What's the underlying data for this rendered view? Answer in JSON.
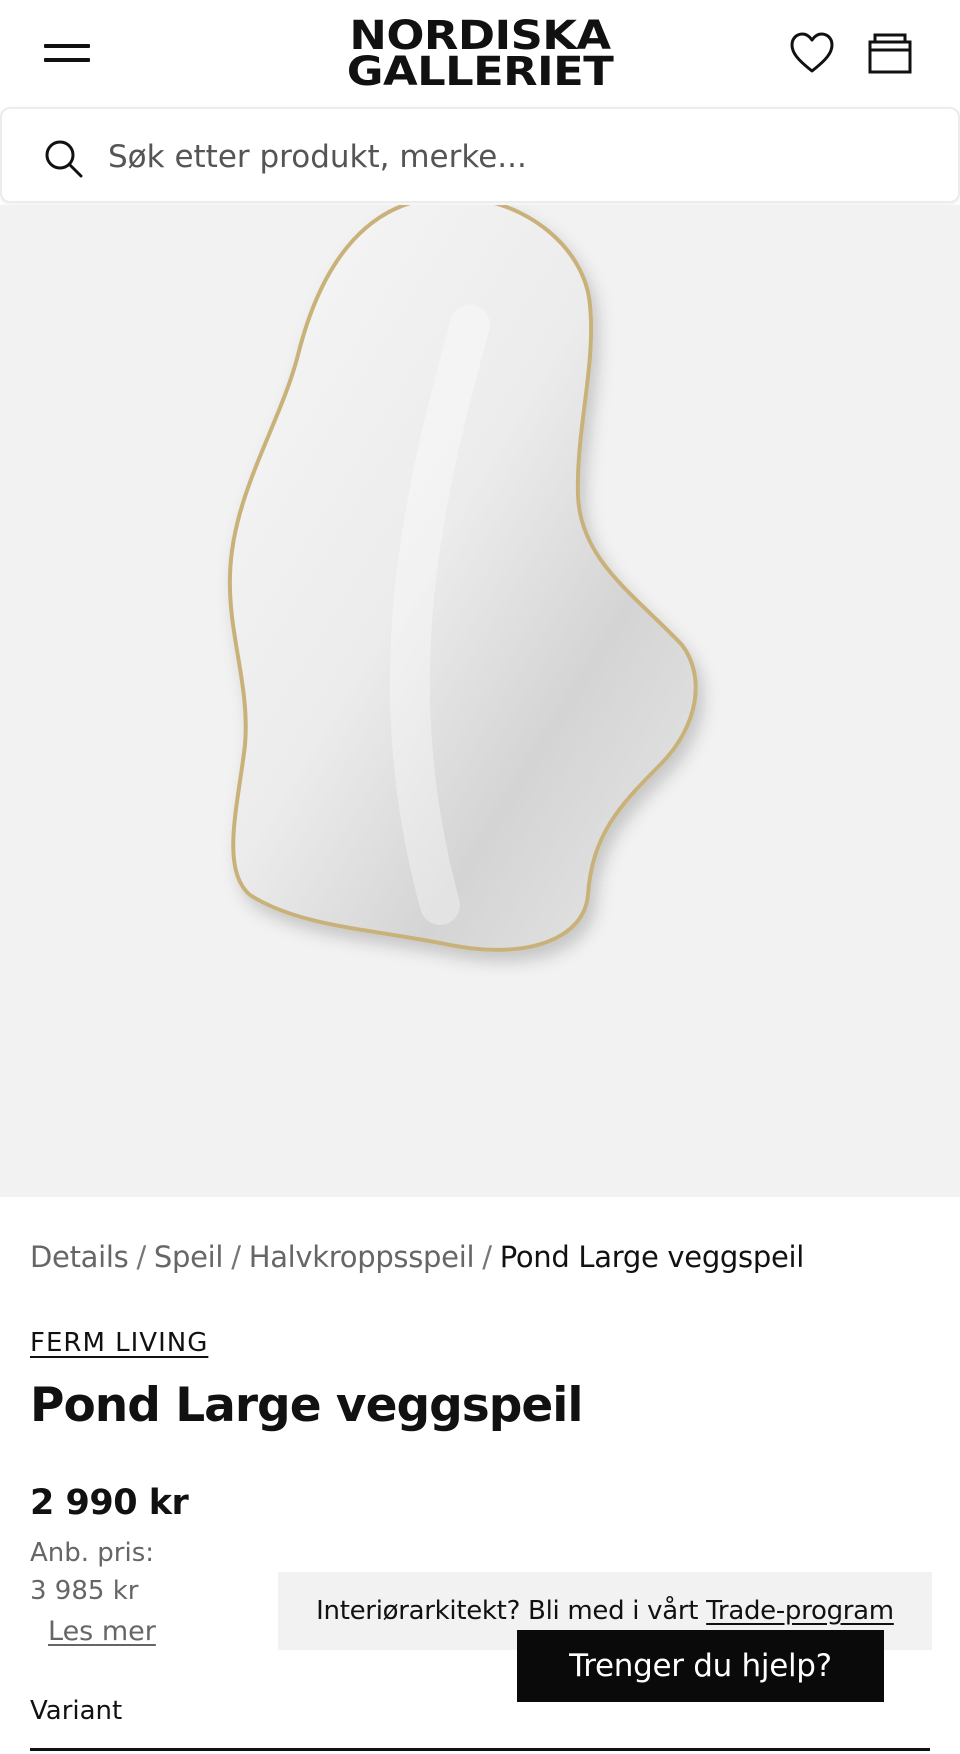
{
  "header": {
    "logo_line1": "NORDISKA",
    "logo_line2": "GALLERIET",
    "menu_icon": "hamburger-menu-icon",
    "wishlist_icon": "heart-icon",
    "cart_icon": "cart-icon"
  },
  "search": {
    "placeholder": "Søk etter produkt, merke...",
    "icon": "search-icon"
  },
  "breadcrumb": {
    "items": [
      "Details",
      "Speil",
      "Halvkroppsspeil"
    ],
    "current": "Pond Large veggspeil",
    "separator": "/"
  },
  "product": {
    "brand": "FERM LIVING",
    "title": "Pond Large veggspeil",
    "price": "2 990 kr",
    "rrp_label": "Anb. pris:",
    "rrp_value": "3 985 kr",
    "read_more": "Les mer",
    "variant_label": "Variant"
  },
  "trade_banner": {
    "text": "Interiørarkitekt? Bli med i vårt",
    "link": "Trade-program"
  },
  "help_button": {
    "label": "Trenger du hjelp?"
  },
  "colors": {
    "background": "#ffffff",
    "image_background": "#f2f2f2",
    "text_primary": "#111111",
    "text_secondary": "#666666",
    "button_dark": "#0a0a0a",
    "mirror_frame": "#c9b27a"
  }
}
